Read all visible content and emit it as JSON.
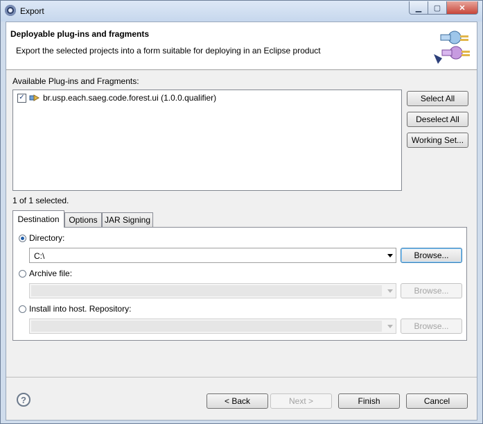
{
  "window": {
    "title": "Export"
  },
  "header": {
    "title": "Deployable plug-ins and fragments",
    "description": "Export the selected projects into a form suitable for deploying in an Eclipse product"
  },
  "available": {
    "label": "Available Plug-ins and Fragments:",
    "items": [
      {
        "label": "br.usp.each.saeg.code.forest.ui (1.0.0.qualifier)",
        "checked": true
      }
    ],
    "status": "1 of 1 selected."
  },
  "side_buttons": {
    "select_all": "Select All",
    "deselect_all": "Deselect All",
    "working_set": "Working Set..."
  },
  "tabs": [
    "Destination",
    "Options",
    "JAR Signing"
  ],
  "destination": {
    "directory_label": "Directory:",
    "directory_value": "C:\\",
    "archive_label": "Archive file:",
    "install_label": "Install into host. Repository:",
    "browse": "Browse..."
  },
  "footer": {
    "back": "< Back",
    "next": "Next >",
    "finish": "Finish",
    "cancel": "Cancel"
  }
}
